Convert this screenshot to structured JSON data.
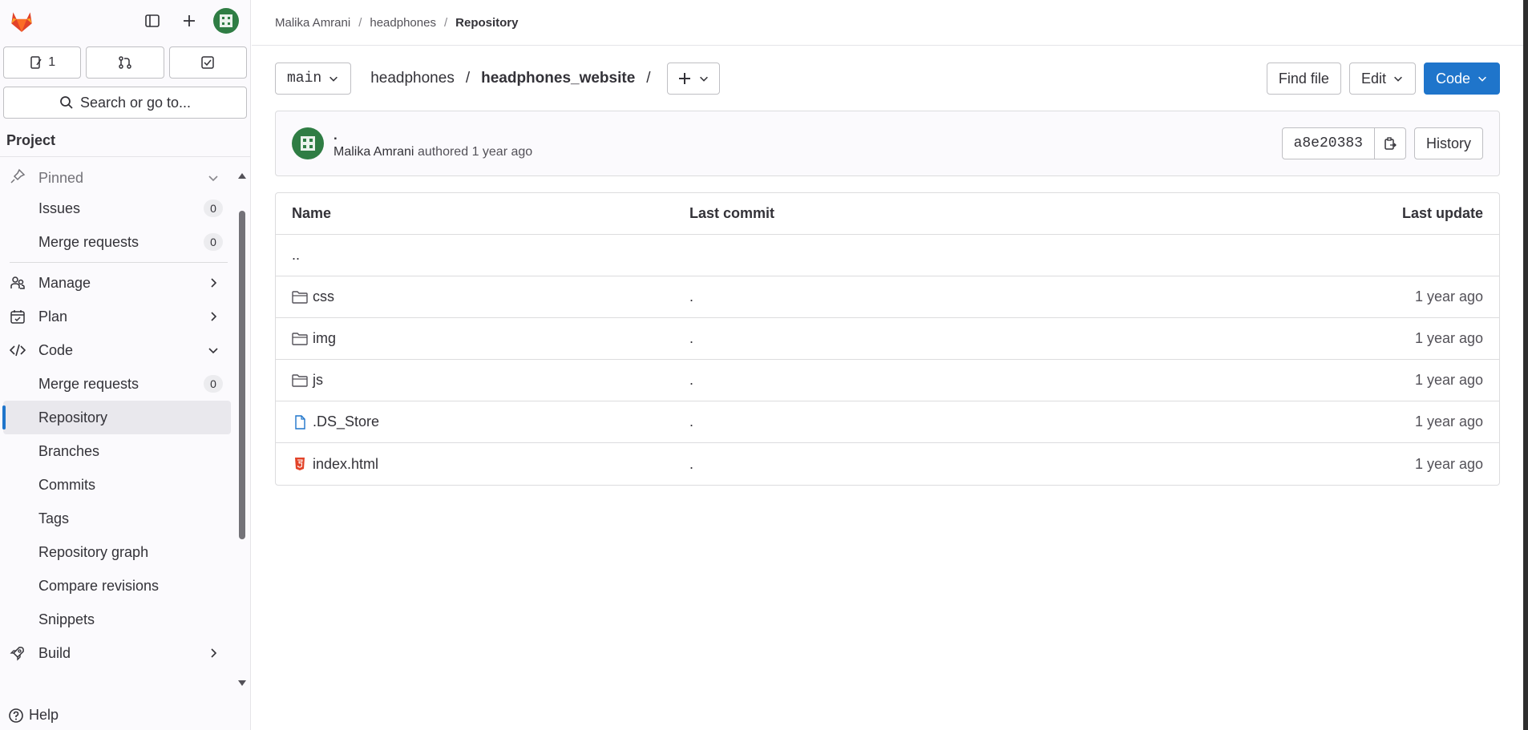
{
  "sidebar": {
    "counts": {
      "issues": "1"
    },
    "search_placeholder": "Search or go to...",
    "section_title": "Project",
    "pinned_label": "Pinned",
    "items": [
      {
        "label": "Issues",
        "badge": "0"
      },
      {
        "label": "Merge requests",
        "badge": "0"
      },
      {
        "label": "Manage"
      },
      {
        "label": "Plan"
      },
      {
        "label": "Code"
      },
      {
        "label": "Merge requests",
        "badge": "0"
      },
      {
        "label": "Repository"
      },
      {
        "label": "Branches"
      },
      {
        "label": "Commits"
      },
      {
        "label": "Tags"
      },
      {
        "label": "Repository graph"
      },
      {
        "label": "Compare revisions"
      },
      {
        "label": "Snippets"
      },
      {
        "label": "Build"
      }
    ],
    "help_label": "Help"
  },
  "breadcrumb": {
    "items": [
      "Malika Amrani",
      "headphones",
      "Repository"
    ]
  },
  "toolbar": {
    "branch": "main",
    "path": [
      "headphones",
      "headphones_website"
    ],
    "find_file": "Find file",
    "edit": "Edit",
    "code": "Code"
  },
  "commit": {
    "title": ".",
    "author": "Malika Amrani",
    "authored_text": "authored",
    "time": "1 year ago",
    "sha": "a8e20383",
    "history": "History"
  },
  "table": {
    "headers": [
      "Name",
      "Last commit",
      "Last update"
    ],
    "rows": [
      {
        "name": "..",
        "commit": "",
        "update": ""
      },
      {
        "name": "css",
        "commit": ".",
        "update": "1 year ago"
      },
      {
        "name": "img",
        "commit": ".",
        "update": "1 year ago"
      },
      {
        "name": "js",
        "commit": ".",
        "update": "1 year ago"
      },
      {
        "name": ".DS_Store",
        "commit": ".",
        "update": "1 year ago"
      },
      {
        "name": "index.html",
        "commit": ".",
        "update": "1 year ago"
      }
    ]
  },
  "colors": {
    "accent": "#1f75cb",
    "brand": "#e24329",
    "avatar": "#2f7d44"
  }
}
